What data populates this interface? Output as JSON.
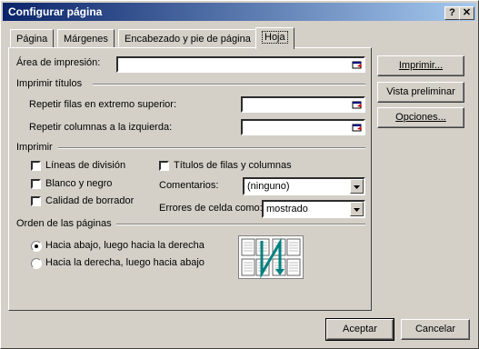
{
  "window": {
    "title": "Configurar página",
    "help_button": "?",
    "close_button": "✕"
  },
  "tabs": [
    {
      "label": "Página"
    },
    {
      "label": "Márgenes"
    },
    {
      "label": "Encabezado y pie de página"
    },
    {
      "label": "Hoja",
      "active": true
    }
  ],
  "print_area": {
    "label": "Área de impresión:",
    "value": ""
  },
  "print_titles": {
    "group_label": "Imprimir títulos",
    "rows_label": "Repetir filas en extremo superior:",
    "rows_value": "",
    "cols_label": "Repetir columnas a la izquierda:",
    "cols_value": ""
  },
  "print": {
    "group_label": "Imprimir",
    "gridlines": {
      "label": "Líneas de división",
      "checked": false
    },
    "black_white": {
      "label": "Blanco y negro",
      "checked": false
    },
    "draft_quality": {
      "label": "Calidad de borrador",
      "checked": false
    },
    "row_col_headings": {
      "label": "Títulos de filas y columnas",
      "checked": false
    },
    "comments_label": "Comentarios:",
    "comments_value": "(ninguno)",
    "errors_label": "Errores de celda como:",
    "errors_value": "mostrado"
  },
  "page_order": {
    "group_label": "Orden de las páginas",
    "down_then_over": {
      "label": "Hacia abajo, luego hacia la derecha",
      "selected": true
    },
    "over_then_down": {
      "label": "Hacia la derecha, luego hacia abajo",
      "selected": false
    }
  },
  "side_buttons": {
    "print": "Imprimir...",
    "preview": "Vista preliminar",
    "options": "Opciones..."
  },
  "footer_buttons": {
    "ok": "Aceptar",
    "cancel": "Cancelar"
  },
  "colors": {
    "titlebar_start": "#0a246a",
    "titlebar_end": "#a6caf0",
    "face": "#d4d0c8"
  }
}
